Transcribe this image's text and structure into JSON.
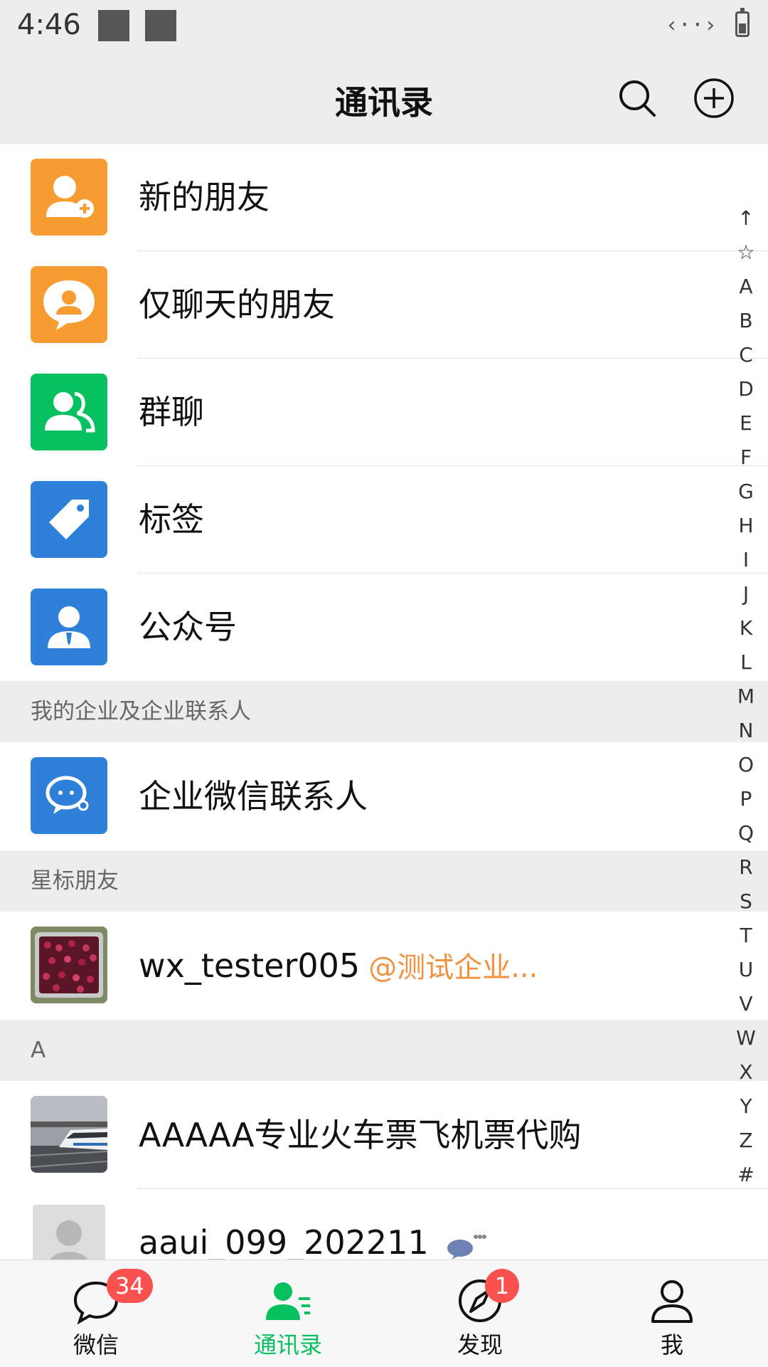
{
  "status_bar": {
    "time": "4:46",
    "network": "‹··›"
  },
  "header": {
    "title": "通讯录"
  },
  "entries": [
    {
      "label": "新的朋友",
      "color": "#f79c31",
      "icon": "add-friend-icon"
    },
    {
      "label": "仅聊天的朋友",
      "color": "#f79c31",
      "icon": "chat-only-friend-icon"
    },
    {
      "label": "群聊",
      "color": "#07c160",
      "icon": "group-chat-icon"
    },
    {
      "label": "标签",
      "color": "#2f80d8",
      "icon": "tag-icon"
    },
    {
      "label": "公众号",
      "color": "#2f80d8",
      "icon": "official-account-icon"
    }
  ],
  "sections": {
    "enterprise": "我的企业及企业联系人",
    "starred": "星标朋友",
    "a": "A"
  },
  "enterprise_contact": {
    "label": "企业微信联系人",
    "color": "#2f80d8",
    "icon": "wecom-icon"
  },
  "starred_contact": {
    "name": "wx_tester005",
    "org": "@测试企业..."
  },
  "contacts_a": [
    {
      "name": "AAAAA专业火车票飞机票代购"
    },
    {
      "name": "aaui_099_202211"
    }
  ],
  "alphabet_index": [
    "↑",
    "☆",
    "A",
    "B",
    "C",
    "D",
    "E",
    "F",
    "G",
    "H",
    "I",
    "J",
    "K",
    "L",
    "M",
    "N",
    "O",
    "P",
    "Q",
    "R",
    "S",
    "T",
    "U",
    "V",
    "W",
    "X",
    "Y",
    "Z",
    "#"
  ],
  "tabs": [
    {
      "label": "微信",
      "badge": "34"
    },
    {
      "label": "通讯录",
      "badge": ""
    },
    {
      "label": "发现",
      "badge": "1"
    },
    {
      "label": "我",
      "badge": ""
    }
  ],
  "colors": {
    "accent": "#07c160",
    "badge": "#fa5151",
    "org_text": "#f0923e"
  }
}
